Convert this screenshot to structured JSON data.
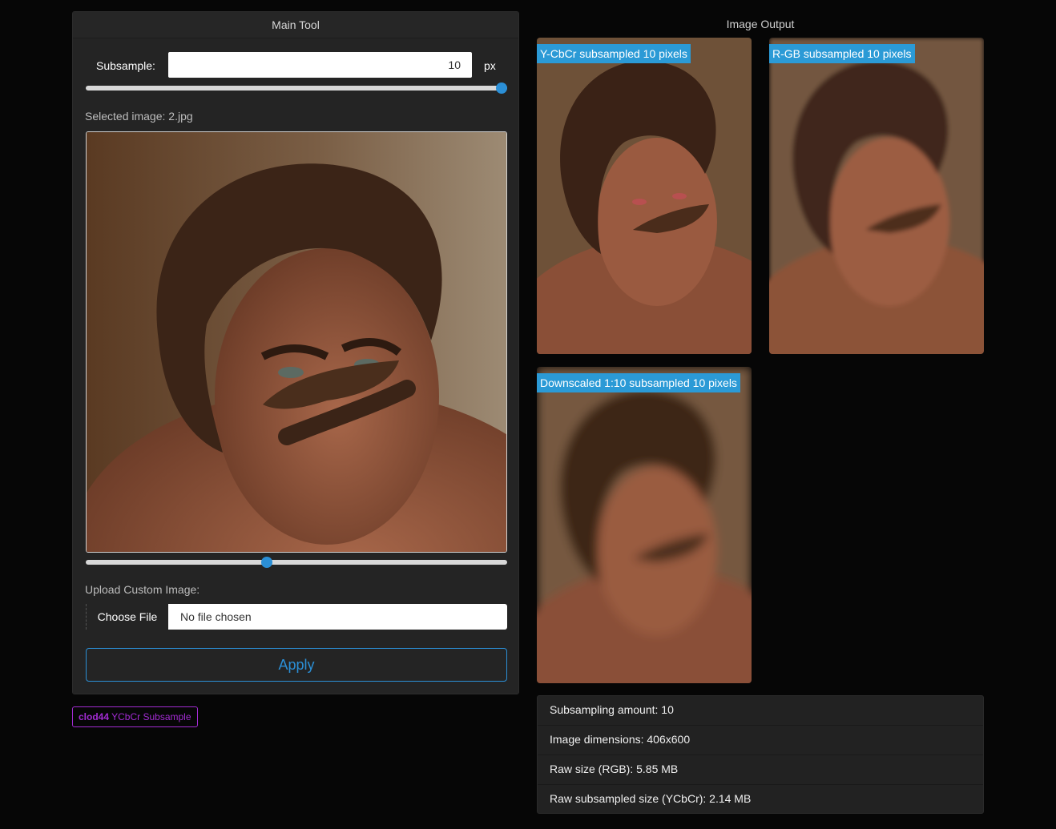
{
  "main_tool": {
    "title": "Main Tool",
    "subsample_label": "Subsample:",
    "subsample_value": "10",
    "subsample_unit": "px",
    "subsample_slider_fraction": 1.0,
    "selected_image_text": "Selected image: 2.jpg",
    "image_slider_fraction": 0.43,
    "upload_label": "Upload Custom Image:",
    "choose_file_label": "Choose File",
    "file_name": "No file chosen",
    "apply_label": "Apply"
  },
  "credit": {
    "author": "clod44",
    "project": "YCbCr Subsample"
  },
  "output": {
    "title": "Image Output",
    "images": [
      {
        "label": "Y-CbCr subsampled 10 pixels"
      },
      {
        "label": "R-GB subsampled 10 pixels"
      },
      {
        "label": "Downscaled 1:10 subsampled 10 pixels"
      }
    ]
  },
  "info": {
    "rows": [
      "Subsampling amount: 10",
      "Image dimensions: 406x600",
      "Raw size (RGB): 5.85 MB",
      "Raw subsampled size (YCbCr): 2.14 MB"
    ]
  },
  "colors": {
    "accent": "#2b8fd6",
    "label_bg": "#2b9ad6",
    "credit": "#a22bd2",
    "panel": "#242424",
    "background": "#060606"
  },
  "icons": [
    "portrait-photo"
  ]
}
